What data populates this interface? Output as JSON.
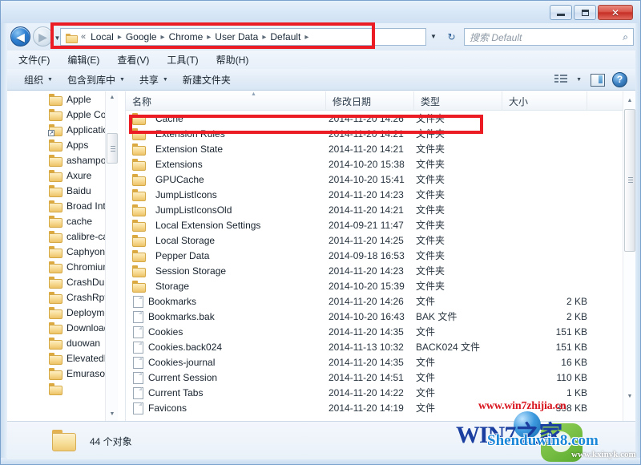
{
  "window": {
    "minimize_label": "",
    "maximize_label": "",
    "close_label": "✕"
  },
  "nav": {
    "back_glyph": "◀",
    "forward_glyph": "▶",
    "history_caret": "▼",
    "refresh_glyph": "↻"
  },
  "breadcrumb": {
    "overflow": "«",
    "separator": "▸",
    "dropdown_caret": "▼",
    "items": [
      "Local",
      "Google",
      "Chrome",
      "User Data",
      "Default"
    ]
  },
  "search": {
    "placeholder": "搜索 Default",
    "icon": "search-icon",
    "magnifier_glyph": "⌕"
  },
  "menubar": {
    "items": [
      "文件(F)",
      "编辑(E)",
      "查看(V)",
      "工具(T)",
      "帮助(H)"
    ]
  },
  "toolbar": {
    "items": [
      {
        "label": "组织",
        "caret": "▼"
      },
      {
        "label": "包含到库中",
        "caret": "▼"
      },
      {
        "label": "共享",
        "caret": "▼"
      },
      {
        "label": "新建文件夹",
        "caret": ""
      }
    ],
    "view_caret": "▼",
    "help_glyph": "?"
  },
  "tree": {
    "scroll_up": "▲",
    "scroll_down": "▼",
    "items": [
      {
        "label": "Apple",
        "icon": "folder-icon"
      },
      {
        "label": "Apple Cor",
        "icon": "folder-icon"
      },
      {
        "label": "Applicatio",
        "icon": "folder-shortcut-icon"
      },
      {
        "label": "Apps",
        "icon": "folder-icon"
      },
      {
        "label": "ashampoo",
        "icon": "folder-icon"
      },
      {
        "label": "Axure",
        "icon": "folder-icon"
      },
      {
        "label": "Baidu",
        "icon": "folder-icon"
      },
      {
        "label": "Broad Inte",
        "icon": "folder-icon"
      },
      {
        "label": "cache",
        "icon": "folder-icon"
      },
      {
        "label": "calibre-ca",
        "icon": "folder-icon"
      },
      {
        "label": "Caphyon",
        "icon": "folder-icon"
      },
      {
        "label": "Chromium",
        "icon": "folder-icon"
      },
      {
        "label": "CrashDum",
        "icon": "folder-icon"
      },
      {
        "label": "CrashRpt",
        "icon": "folder-icon"
      },
      {
        "label": "Deployme",
        "icon": "folder-icon"
      },
      {
        "label": "Download",
        "icon": "folder-icon"
      },
      {
        "label": "duowan",
        "icon": "folder-icon"
      },
      {
        "label": "ElevatedD",
        "icon": "folder-icon"
      },
      {
        "label": "Emurasoft",
        "icon": "folder-icon"
      },
      {
        "label": "",
        "icon": "folder-icon"
      }
    ]
  },
  "filelist": {
    "columns": [
      "名称",
      "修改日期",
      "类型",
      "大小"
    ],
    "sort_indicator": "▲",
    "scroll_up": "▲",
    "scroll_down": "▼",
    "rows": [
      {
        "name": "Cache",
        "date": "2014-11-20 14:26",
        "type": "文件夹",
        "size": "",
        "icon": "folder-icon",
        "highlighted": true
      },
      {
        "name": "Extension Rules",
        "date": "2014-11-20 14:21",
        "type": "文件夹",
        "size": "",
        "icon": "folder-icon",
        "highlighted": false
      },
      {
        "name": "Extension State",
        "date": "2014-11-20 14:21",
        "type": "文件夹",
        "size": "",
        "icon": "folder-icon",
        "highlighted": false
      },
      {
        "name": "Extensions",
        "date": "2014-10-20 15:38",
        "type": "文件夹",
        "size": "",
        "icon": "folder-icon",
        "highlighted": false
      },
      {
        "name": "GPUCache",
        "date": "2014-10-20 15:41",
        "type": "文件夹",
        "size": "",
        "icon": "folder-icon",
        "highlighted": false
      },
      {
        "name": "JumpListIcons",
        "date": "2014-11-20 14:23",
        "type": "文件夹",
        "size": "",
        "icon": "folder-icon",
        "highlighted": false
      },
      {
        "name": "JumpListIconsOld",
        "date": "2014-11-20 14:21",
        "type": "文件夹",
        "size": "",
        "icon": "folder-icon",
        "highlighted": false
      },
      {
        "name": "Local Extension Settings",
        "date": "2014-09-21 11:47",
        "type": "文件夹",
        "size": "",
        "icon": "folder-icon",
        "highlighted": false
      },
      {
        "name": "Local Storage",
        "date": "2014-11-20 14:25",
        "type": "文件夹",
        "size": "",
        "icon": "folder-icon",
        "highlighted": false
      },
      {
        "name": "Pepper Data",
        "date": "2014-09-18 16:53",
        "type": "文件夹",
        "size": "",
        "icon": "folder-icon",
        "highlighted": false
      },
      {
        "name": "Session Storage",
        "date": "2014-11-20 14:23",
        "type": "文件夹",
        "size": "",
        "icon": "folder-icon",
        "highlighted": false
      },
      {
        "name": "Storage",
        "date": "2014-10-20 15:39",
        "type": "文件夹",
        "size": "",
        "icon": "folder-icon",
        "highlighted": false
      },
      {
        "name": "Bookmarks",
        "date": "2014-11-20 14:26",
        "type": "文件",
        "size": "2 KB",
        "icon": "file-icon",
        "highlighted": false
      },
      {
        "name": "Bookmarks.bak",
        "date": "2014-10-20 16:43",
        "type": "BAK 文件",
        "size": "2 KB",
        "icon": "file-icon",
        "highlighted": false
      },
      {
        "name": "Cookies",
        "date": "2014-11-20 14:35",
        "type": "文件",
        "size": "151 KB",
        "icon": "file-icon",
        "highlighted": false
      },
      {
        "name": "Cookies.back024",
        "date": "2014-11-13 10:32",
        "type": "BACK024 文件",
        "size": "151 KB",
        "icon": "file-icon",
        "highlighted": false
      },
      {
        "name": "Cookies-journal",
        "date": "2014-11-20 14:35",
        "type": "文件",
        "size": "16 KB",
        "icon": "file-icon",
        "highlighted": false
      },
      {
        "name": "Current Session",
        "date": "2014-11-20 14:51",
        "type": "文件",
        "size": "110 KB",
        "icon": "file-icon",
        "highlighted": false
      },
      {
        "name": "Current Tabs",
        "date": "2014-11-20 14:22",
        "type": "文件",
        "size": "1 KB",
        "icon": "file-icon",
        "highlighted": false
      },
      {
        "name": "Favicons",
        "date": "2014-11-20 14:19",
        "type": "文件",
        "size": "308 KB",
        "icon": "file-icon",
        "highlighted": false
      }
    ]
  },
  "statusbar": {
    "text": "44 个对象",
    "icon": "folder-icon"
  },
  "watermarks": {
    "line1": "www.win7zhijia.cn",
    "line2": "WIN7之家",
    "line3": "Shenduwin8.com",
    "line4": "www.kxinyk.com"
  },
  "colors": {
    "annotation_red": "#ec1c24",
    "frame_blue": "#b6cfe8",
    "close_red": "#c62f26"
  }
}
